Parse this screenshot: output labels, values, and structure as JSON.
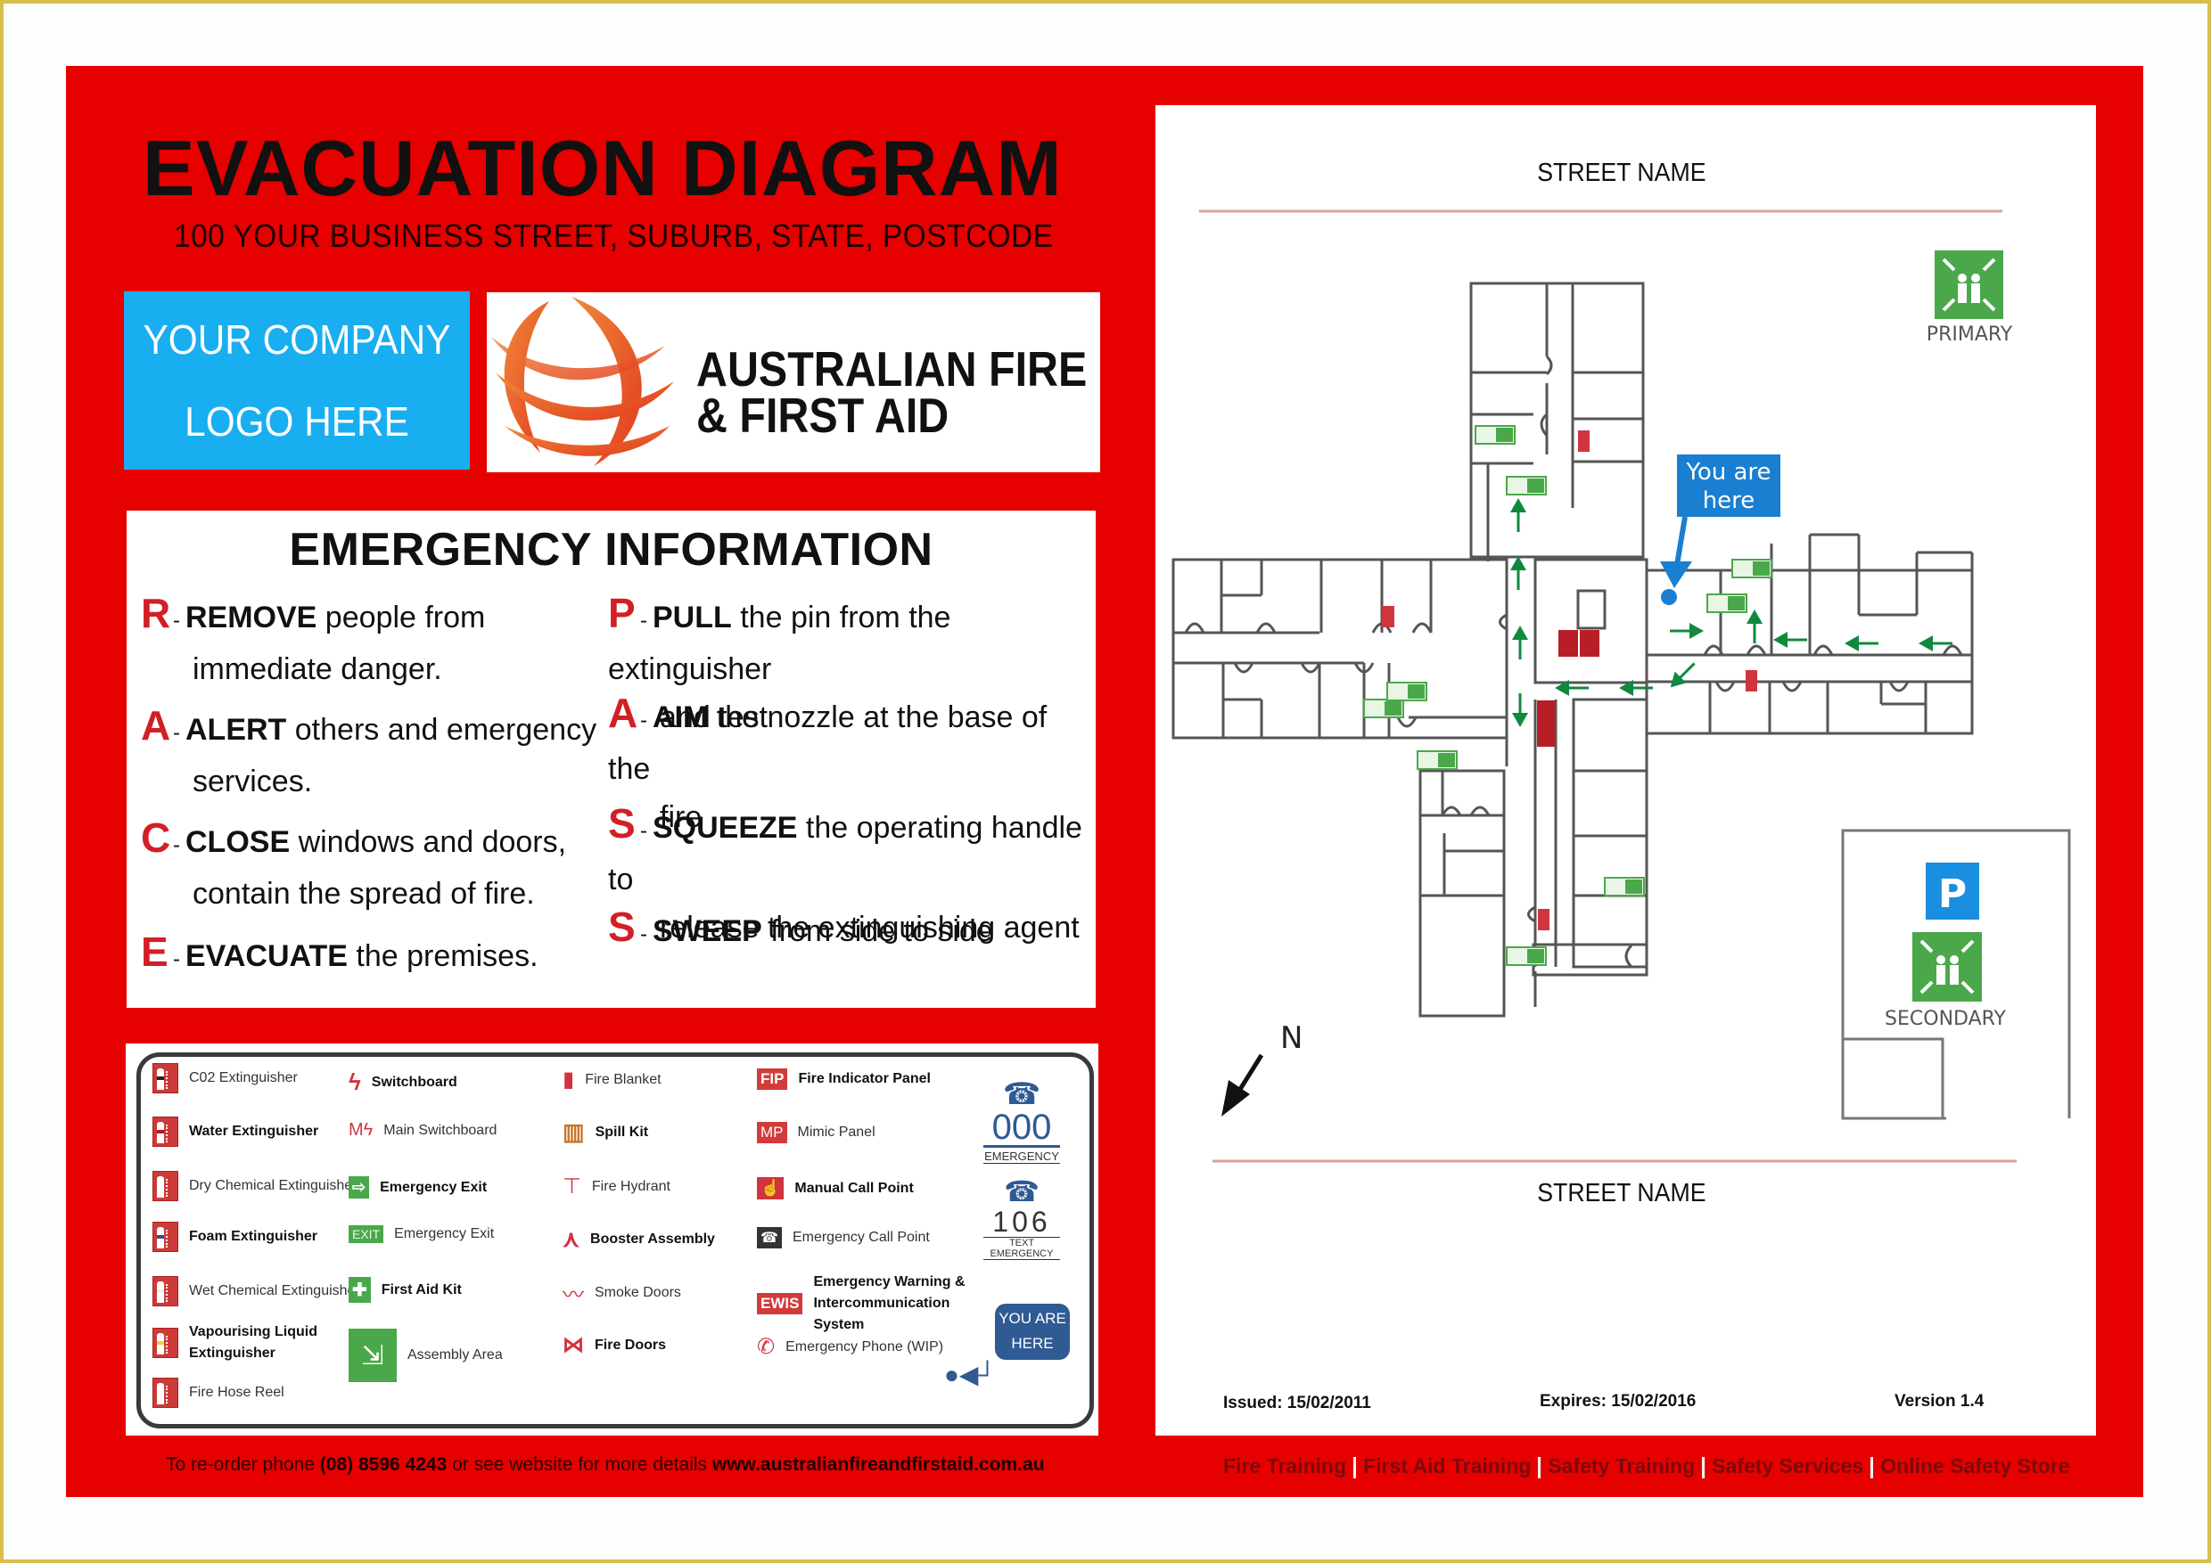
{
  "header": {
    "title": "EVACUATION DIAGRAM",
    "address": "100 YOUR BUSINESS STREET, SUBURB, STATE, POSTCODE"
  },
  "logos": {
    "placeholder_line1": "YOUR COMPANY",
    "placeholder_line2": "LOGO HERE",
    "brand_line1": "AUSTRALIAN FIRE",
    "brand_line2": "& FIRST AID"
  },
  "emergency_info": {
    "title": "EMERGENCY INFORMATION",
    "race": [
      {
        "letter": "R",
        "keyword": "REMOVE",
        "text": " people from",
        "cont": "immediate danger."
      },
      {
        "letter": "A",
        "keyword": "ALERT",
        "text": " others and emergency",
        "cont": "services."
      },
      {
        "letter": "C",
        "keyword": "CLOSE",
        "text": " windows and doors,",
        "cont": "contain the spread of fire."
      },
      {
        "letter": "E",
        "keyword": "EVACUATE",
        "text": " the premises.",
        "cont": ""
      }
    ],
    "pass": [
      {
        "letter": "P",
        "keyword": "PULL",
        "text": " the pin from the extinguisher",
        "cont": "and test"
      },
      {
        "letter": "A",
        "keyword": "AIM",
        "text": " the nozzle at the base of the",
        "cont": "fire"
      },
      {
        "letter": "S",
        "keyword": "SQUEEZE",
        "text": " the operating handle to",
        "cont": "release the extinguishing agent"
      },
      {
        "letter": "S",
        "keyword": "SWEEP",
        "text": " from side to side",
        "cont": ""
      }
    ]
  },
  "legend": {
    "col1": [
      {
        "label": "C02 Extinguisher",
        "icon": "co2-extinguisher-icon",
        "bold": false,
        "band": "#222222"
      },
      {
        "label": "Water Extinguisher",
        "icon": "water-extinguisher-icon",
        "bold": true,
        "band": "#c0141e"
      },
      {
        "label": "Dry Chemical Extinguisher",
        "icon": "dry-chemical-extinguisher-icon",
        "bold": false,
        "band": "#ffffff"
      },
      {
        "label": "Foam Extinguisher",
        "icon": "foam-extinguisher-icon",
        "bold": true,
        "band": "#2c4fa0"
      },
      {
        "label": "Wet Chemical Extinguisher",
        "icon": "wet-chemical-extinguisher-icon",
        "bold": false,
        "band": "#f0f0f0"
      },
      {
        "label": "Vapourising Liquid",
        "label2": "Extinguisher",
        "icon": "vapourising-liquid-extinguisher-icon",
        "bold": true,
        "band": "#f2d22e"
      },
      {
        "label": "Fire Hose Reel",
        "icon": "fire-hose-reel-icon",
        "bold": false
      }
    ],
    "col2": [
      {
        "label": "Switchboard",
        "icon": "switchboard-icon",
        "bold": true
      },
      {
        "label": "Main Switchboard",
        "icon": "main-switchboard-icon",
        "bold": false,
        "prefix": "M"
      },
      {
        "label": "Emergency Exit",
        "icon": "emergency-exit-running-man-icon",
        "bold": true
      },
      {
        "label": "Emergency Exit",
        "icon": "exit-sign-icon",
        "bold": false,
        "sign": "EXIT"
      },
      {
        "label": "First Aid Kit",
        "icon": "first-aid-kit-icon",
        "bold": true
      },
      {
        "label": "Assembly Area",
        "icon": "assembly-area-icon",
        "bold": false
      }
    ],
    "col3": [
      {
        "label": "Fire Blanket",
        "icon": "fire-blanket-icon",
        "bold": false
      },
      {
        "label": "Spill Kit",
        "icon": "spill-kit-icon",
        "bold": true
      },
      {
        "label": "Fire Hydrant",
        "icon": "fire-hydrant-icon",
        "bold": false
      },
      {
        "label": "Booster Assembly",
        "icon": "booster-assembly-icon",
        "bold": true
      },
      {
        "label": "Smoke Doors",
        "icon": "smoke-doors-icon",
        "bold": false
      },
      {
        "label": "Fire Doors",
        "icon": "fire-doors-icon",
        "bold": true
      }
    ],
    "col4": [
      {
        "label": "Fire Indicator Panel",
        "icon": "fire-indicator-panel-icon",
        "bold": true,
        "code": "FIP"
      },
      {
        "label": "Mimic Panel",
        "icon": "mimic-panel-icon",
        "bold": false,
        "code": "MP"
      },
      {
        "label": "Manual Call Point",
        "icon": "manual-call-point-icon",
        "bold": true
      },
      {
        "label": "Emergency Call Point",
        "icon": "emergency-call-point-icon",
        "bold": false
      },
      {
        "label": "Emergency Warning &",
        "label2": "Intercommunication",
        "label3": "System",
        "icon": "ewis-icon",
        "bold": true,
        "code": "EWIS"
      },
      {
        "label": "Emergency Phone (WIP)",
        "icon": "emergency-phone-icon",
        "bold": false
      }
    ],
    "phones": {
      "emergency_number": "000",
      "emergency_label": "EMERGENCY",
      "text_number": "106",
      "text_label": "TEXT EMERGENCY",
      "you_are_here_line1": "YOU ARE",
      "you_are_here_line2": "HERE"
    }
  },
  "footer": {
    "reorder_prefix": "To re-order phone ",
    "phone": "(08) 8596 4243",
    "reorder_middle": " or see website for more details ",
    "website": "www.australianfireandfirstaid.com.au"
  },
  "map": {
    "street_top": "STREET NAME",
    "street_bottom": "STREET NAME",
    "primary_label": "PRIMARY",
    "secondary_label": "SECONDARY",
    "parking_label": "P",
    "north_label": "N",
    "you_are_here_line1": "You are",
    "you_are_here_line2": "here",
    "issued": "Issued: 15/02/2011",
    "expires": "Expires: 15/02/2016",
    "version": "Version 1.4"
  },
  "links": [
    "Fire Training",
    "First Aid Training",
    "Safety Training",
    "Safety Services",
    "Online Safety Store"
  ],
  "colors": {
    "panel_red": "#e60000",
    "letter_red": "#d21f26",
    "logo_blue": "#18aef0",
    "exit_green": "#4aa84a",
    "arrow_green": "#10893e",
    "marker_blue": "#1a7fd0",
    "phone_navy": "#2f5a94",
    "frame_gold": "#d9bd4a"
  }
}
